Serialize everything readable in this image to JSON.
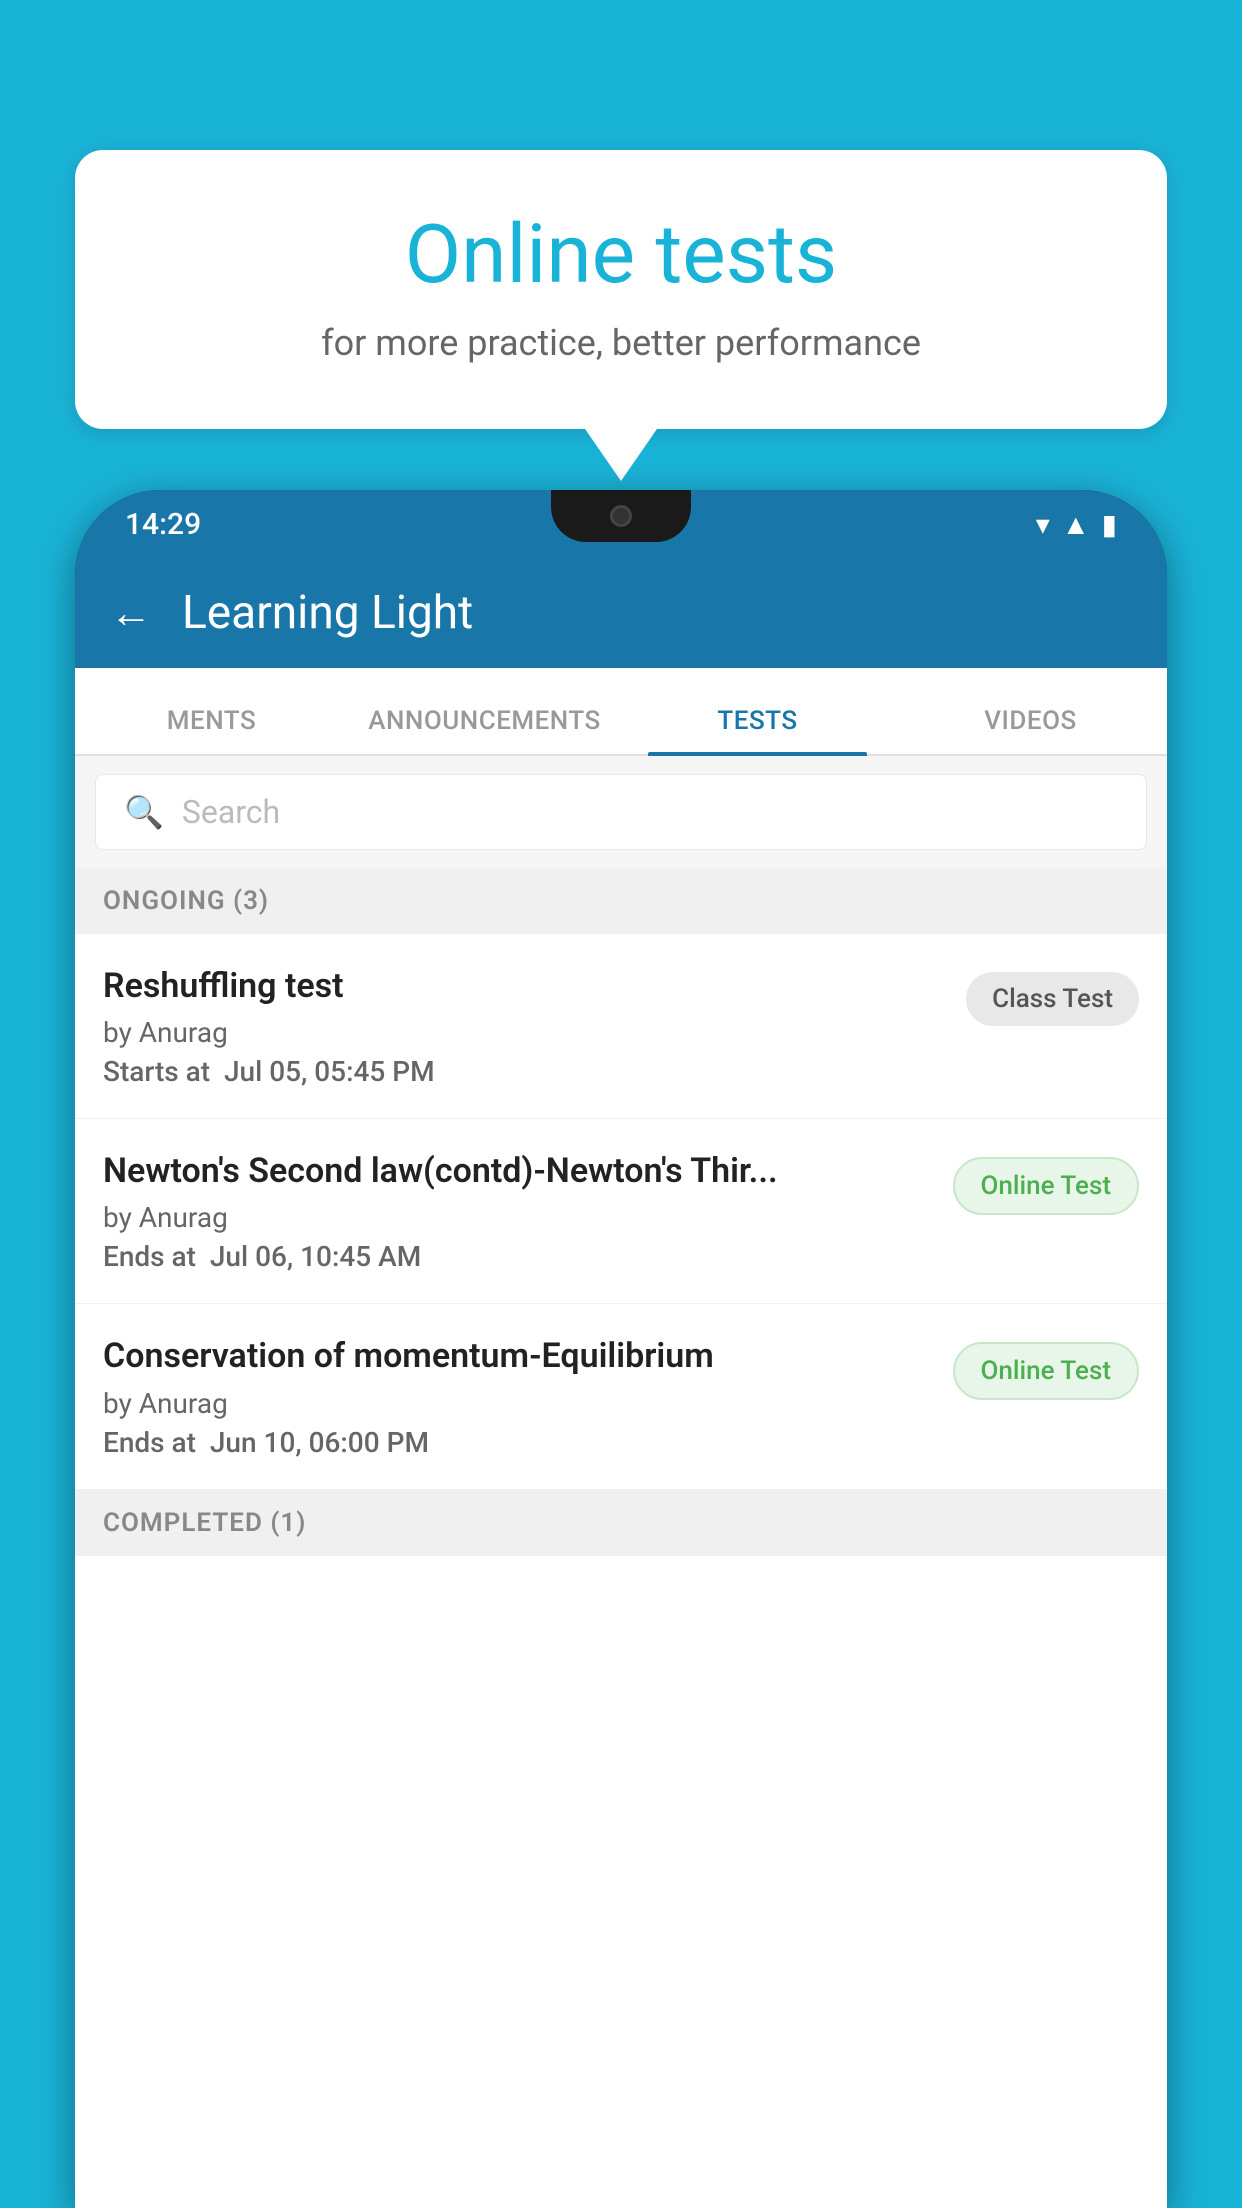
{
  "background": {
    "color": "#1ab3d8"
  },
  "speech_bubble": {
    "title": "Online tests",
    "subtitle": "for more practice, better performance"
  },
  "phone": {
    "status_bar": {
      "time": "14:29",
      "wifi": "▼",
      "signal": "▲",
      "battery": "▮"
    },
    "app_bar": {
      "title": "Learning Light",
      "back_label": "←"
    },
    "tabs": [
      {
        "label": "MENTS",
        "active": false
      },
      {
        "label": "ANNOUNCEMENTS",
        "active": false
      },
      {
        "label": "TESTS",
        "active": true
      },
      {
        "label": "VIDEOS",
        "active": false
      }
    ],
    "search": {
      "placeholder": "Search"
    },
    "ongoing_section": {
      "label": "ONGOING (3)"
    },
    "tests": [
      {
        "title": "Reshuffling test",
        "author": "by Anurag",
        "date_label": "Starts at",
        "date": "Jul 05, 05:45 PM",
        "badge": "Class Test",
        "badge_type": "class"
      },
      {
        "title": "Newton's Second law(contd)-Newton's Thir...",
        "author": "by Anurag",
        "date_label": "Ends at",
        "date": "Jul 06, 10:45 AM",
        "badge": "Online Test",
        "badge_type": "online"
      },
      {
        "title": "Conservation of momentum-Equilibrium",
        "author": "by Anurag",
        "date_label": "Ends at",
        "date": "Jun 10, 06:00 PM",
        "badge": "Online Test",
        "badge_type": "online"
      }
    ],
    "completed_section": {
      "label": "COMPLETED (1)"
    }
  }
}
